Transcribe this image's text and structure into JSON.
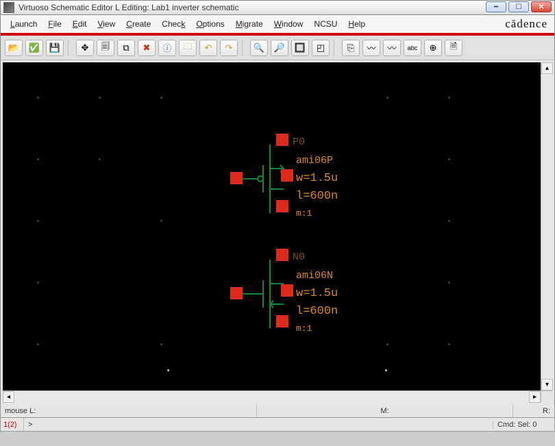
{
  "window": {
    "title": "Virtuoso Schematic Editor L Editing: Lab1 inverter schematic"
  },
  "brand": "cādence",
  "menus": {
    "launch": "Launch",
    "file": "File",
    "edit": "Edit",
    "view": "View",
    "create": "Create",
    "check": "Check",
    "options": "Options",
    "migrate": "Migrate",
    "window": "Window",
    "ncsu": "NCSU",
    "help": "Help"
  },
  "toolbar": {
    "open": "📂",
    "check": "✅",
    "save": "💾",
    "move": "✥",
    "copy": "🗐",
    "stretch": "⧉",
    "delete": "✖",
    "info": "ⓘ",
    "descend": "🗀",
    "undo": "↶",
    "redo": "↷",
    "zoomin": "🔍",
    "zoomout": "🔎",
    "zoomfit": "🔲",
    "zoomsel": "◰",
    "instance": "⎘",
    "wire": "〰",
    "wirewide": "〰",
    "label": "abc",
    "pin": "⊕",
    "note": "🗎"
  },
  "status": {
    "mouseL": "mouse L:",
    "mouseM": "M:",
    "mouseR": "R:",
    "index": "1(2)",
    "prompt": ">",
    "cmdsel": "Cmd: Sel: 0"
  },
  "devices": {
    "pmos": {
      "name": "P0",
      "model": "ami06P",
      "w": "w=1.5u",
      "l": "l=600n",
      "m": "m:1"
    },
    "nmos": {
      "name": "N0",
      "model": "ami06N",
      "w": "w=1.5u",
      "l": "l=600n",
      "m": "m:1"
    }
  }
}
